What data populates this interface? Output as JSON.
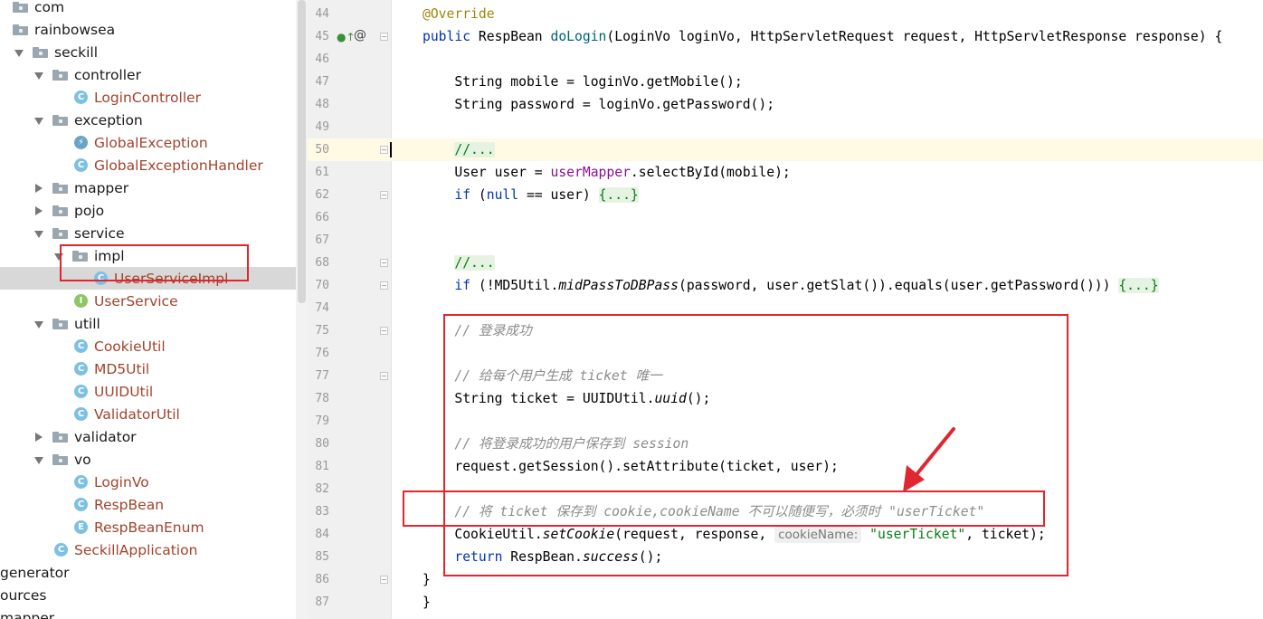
{
  "tree": {
    "items": [
      {
        "label": "com",
        "indent": 0,
        "kind": "folder",
        "arrow": "none"
      },
      {
        "label": "rainbowsea",
        "indent": 0,
        "kind": "folder",
        "arrow": "none"
      },
      {
        "label": "seckill",
        "indent": 1,
        "kind": "folder",
        "arrow": "down"
      },
      {
        "label": "controller",
        "indent": 2,
        "kind": "folder",
        "arrow": "down"
      },
      {
        "label": "LoginController",
        "indent": 3,
        "kind": "class",
        "arrow": "none"
      },
      {
        "label": "exception",
        "indent": 2,
        "kind": "folder",
        "arrow": "down"
      },
      {
        "label": "GlobalException",
        "indent": 3,
        "kind": "exception",
        "arrow": "none"
      },
      {
        "label": "GlobalExceptionHandler",
        "indent": 3,
        "kind": "class",
        "arrow": "none"
      },
      {
        "label": "mapper",
        "indent": 2,
        "kind": "folder",
        "arrow": "right"
      },
      {
        "label": "pojo",
        "indent": 2,
        "kind": "folder",
        "arrow": "right"
      },
      {
        "label": "service",
        "indent": 2,
        "kind": "folder",
        "arrow": "down"
      },
      {
        "label": "impl",
        "indent": 3,
        "kind": "folder",
        "arrow": "down"
      },
      {
        "label": "UserServiceImpl",
        "indent": 4,
        "kind": "class",
        "arrow": "none",
        "selected": true
      },
      {
        "label": "UserService",
        "indent": 3,
        "kind": "interface",
        "arrow": "none"
      },
      {
        "label": "utill",
        "indent": 2,
        "kind": "folder",
        "arrow": "down"
      },
      {
        "label": "CookieUtil",
        "indent": 3,
        "kind": "class",
        "arrow": "none"
      },
      {
        "label": "MD5Util",
        "indent": 3,
        "kind": "class",
        "arrow": "none"
      },
      {
        "label": "UUIDUtil",
        "indent": 3,
        "kind": "class",
        "arrow": "none"
      },
      {
        "label": "ValidatorUtil",
        "indent": 3,
        "kind": "class",
        "arrow": "none"
      },
      {
        "label": "validator",
        "indent": 2,
        "kind": "folder",
        "arrow": "right"
      },
      {
        "label": "vo",
        "indent": 2,
        "kind": "folder",
        "arrow": "down"
      },
      {
        "label": "LoginVo",
        "indent": 3,
        "kind": "class",
        "arrow": "none"
      },
      {
        "label": "RespBean",
        "indent": 3,
        "kind": "class",
        "arrow": "none"
      },
      {
        "label": "RespBeanEnum",
        "indent": 3,
        "kind": "enum",
        "arrow": "none"
      },
      {
        "label": "SeckillApplication",
        "indent": 2,
        "kind": "class",
        "arrow": "none"
      },
      {
        "label": "generator",
        "indent": 0,
        "kind": "text",
        "arrow": "none"
      },
      {
        "label": "ources",
        "indent": 0,
        "kind": "text",
        "arrow": "none"
      },
      {
        "label": "mapper",
        "indent": 0,
        "kind": "text",
        "arrow": "none"
      }
    ]
  },
  "editor": {
    "lines": [
      {
        "num": "44",
        "segments": [
          [
            "an",
            "@Override"
          ]
        ]
      },
      {
        "num": "45",
        "segments": [
          [
            "kw",
            "public "
          ],
          [
            "",
            "RespBean "
          ],
          [
            "mt",
            "doLogin"
          ],
          [
            "",
            "(LoginVo loginVo, HttpServletRequest request, HttpServletResponse response) {"
          ]
        ]
      },
      {
        "num": "46",
        "segments": []
      },
      {
        "num": "47",
        "segments": [
          [
            "",
            "    String mobile = loginVo.getMobile();"
          ]
        ]
      },
      {
        "num": "48",
        "segments": [
          [
            "",
            "    String password = loginVo.getPassword();"
          ]
        ]
      },
      {
        "num": "49",
        "segments": []
      },
      {
        "num": "50",
        "segments": [
          [
            "",
            "    "
          ],
          [
            "fd",
            "//..."
          ]
        ],
        "current": true
      },
      {
        "num": "61",
        "segments": [
          [
            "",
            "    User user = "
          ],
          [
            "fld",
            "userMapper"
          ],
          [
            "",
            ".selectById(mobile);"
          ]
        ]
      },
      {
        "num": "62",
        "segments": [
          [
            "",
            "    "
          ],
          [
            "kw",
            "if "
          ],
          [
            "",
            "("
          ],
          [
            "kw",
            "null "
          ],
          [
            "",
            "== user) "
          ],
          [
            "fd",
            "{...}"
          ]
        ]
      },
      {
        "num": "66",
        "segments": []
      },
      {
        "num": "67",
        "segments": []
      },
      {
        "num": "68",
        "segments": [
          [
            "",
            "    "
          ],
          [
            "fd",
            "//..."
          ]
        ]
      },
      {
        "num": "70",
        "segments": [
          [
            "",
            "    "
          ],
          [
            "kw",
            "if "
          ],
          [
            "",
            "(!MD5Util."
          ],
          [
            "it",
            "midPassToDBPass"
          ],
          [
            "",
            "(password, user.getSlat()).equals(user.getPassword())) "
          ],
          [
            "fd",
            "{...}"
          ]
        ]
      },
      {
        "num": "74",
        "segments": []
      },
      {
        "num": "75",
        "segments": [
          [
            "",
            "    "
          ],
          [
            "cm",
            "// 登录成功"
          ]
        ]
      },
      {
        "num": "76",
        "segments": []
      },
      {
        "num": "77",
        "segments": [
          [
            "",
            "    "
          ],
          [
            "cm",
            "// 给每个用户生成 ticket 唯一"
          ]
        ]
      },
      {
        "num": "78",
        "segments": [
          [
            "",
            "    String ticket = UUIDUtil."
          ],
          [
            "it",
            "uuid"
          ],
          [
            "",
            "();"
          ]
        ]
      },
      {
        "num": "79",
        "segments": []
      },
      {
        "num": "80",
        "segments": [
          [
            "",
            "    "
          ],
          [
            "cm",
            "// 将登录成功的用户保存到 session"
          ]
        ]
      },
      {
        "num": "81",
        "segments": [
          [
            "",
            "    request.getSession().setAttribute(ticket, user);"
          ]
        ]
      },
      {
        "num": "82",
        "segments": []
      },
      {
        "num": "83",
        "segments": [
          [
            "",
            "    "
          ],
          [
            "cm",
            "// 将 ticket 保存到 cookie,cookieName 不可以随便写，必须时 \"userTicket\""
          ]
        ]
      },
      {
        "num": "84",
        "segments": [
          [
            "",
            "    CookieUtil."
          ],
          [
            "it",
            "setCookie"
          ],
          [
            "",
            "(request, response, "
          ],
          [
            "hint",
            "cookieName:"
          ],
          [
            "st",
            " \"userTicket\""
          ],
          [
            "",
            ", ticket);"
          ]
        ]
      },
      {
        "num": "85",
        "segments": [
          [
            "",
            "    "
          ],
          [
            "kw",
            "return "
          ],
          [
            "",
            "RespBean."
          ],
          [
            "it",
            "success"
          ],
          [
            "",
            "();"
          ]
        ]
      },
      {
        "num": "86",
        "segments": [
          [
            "",
            "}"
          ]
        ]
      },
      {
        "num": "87",
        "segments": [
          [
            "",
            "}"
          ]
        ]
      }
    ]
  },
  "colors": {
    "annotation": "#e0262f",
    "keyword": "#0033b3",
    "string": "#067d17",
    "comment": "#8c8c8c",
    "annotation_code": "#9e880d",
    "field": "#871094",
    "method": "#00627a"
  },
  "icons": {
    "gutter_impl": "implemented-method-icon",
    "gutter_override": "at-icon"
  }
}
